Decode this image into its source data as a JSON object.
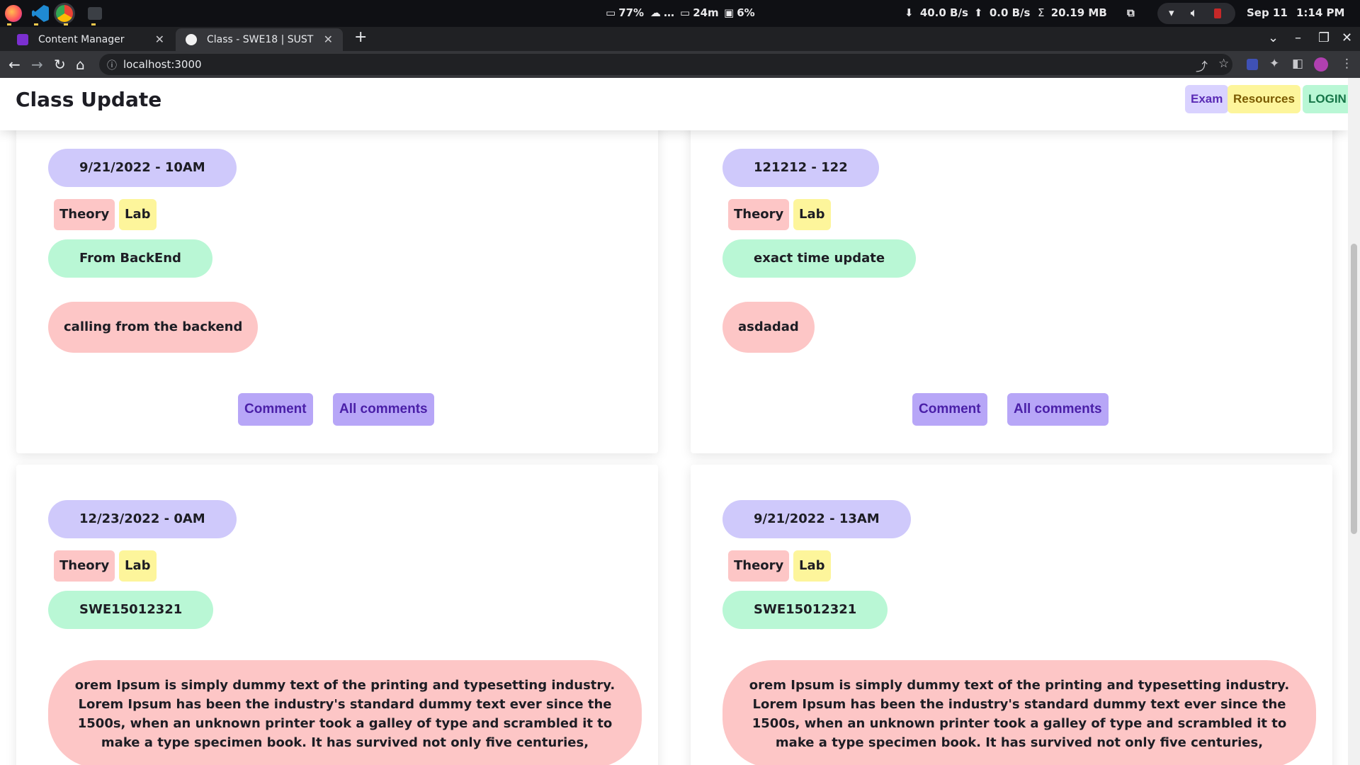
{
  "os": {
    "battery": "77%",
    "cloud": "…",
    "screen_time": "24m",
    "disk": "6%",
    "net_down": "40.0 B/s",
    "net_up": "0.0 B/s",
    "net_total": "20.19 MB",
    "date": "Sep 11",
    "time": "1:14 PM"
  },
  "browser": {
    "tabs": [
      {
        "label": "Content Manager"
      },
      {
        "label": "Class - SWE18 | SUST"
      }
    ],
    "url": "localhost:3000"
  },
  "header": {
    "title": "Class Update",
    "exam": "Exam",
    "resources": "Resources",
    "login": "LOGIN"
  },
  "cards": [
    {
      "date": "9/21/2022 - 10AM",
      "tags": [
        "Theory",
        "Lab"
      ],
      "title": "From BackEnd",
      "body": "calling from the backend",
      "comment": "Comment",
      "all_comments": "All comments"
    },
    {
      "date": "121212 - 122",
      "tags": [
        "Theory",
        "Lab"
      ],
      "title": "exact time update",
      "body": "asdadad",
      "comment": "Comment",
      "all_comments": "All comments"
    },
    {
      "date": "12/23/2022 - 0AM",
      "tags": [
        "Theory",
        "Lab"
      ],
      "title": "SWE15012321",
      "body": "orem Ipsum is simply dummy text of the printing and typesetting industry. Lorem Ipsum has been the industry's standard dummy text ever since the 1500s, when an unknown printer took a galley of type and scrambled it to make a type specimen book. It has survived not only five centuries,"
    },
    {
      "date": "9/21/2022 - 13AM",
      "tags": [
        "Theory",
        "Lab"
      ],
      "title": "SWE15012321",
      "body": "orem Ipsum is simply dummy text of the printing and typesetting industry. Lorem Ipsum has been the industry's standard dummy text ever since the 1500s, when an unknown printer took a galley of type and scrambled it to make a type specimen book. It has survived not only five centuries,"
    }
  ]
}
